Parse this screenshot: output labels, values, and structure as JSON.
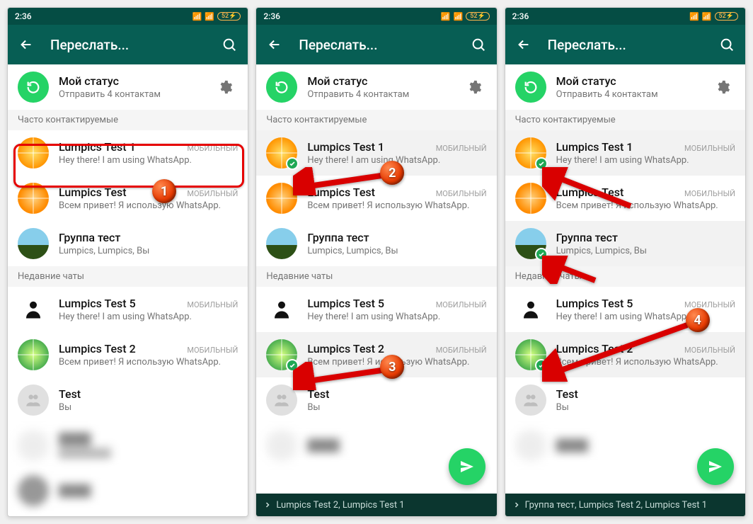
{
  "status_bar": {
    "time": "2:36",
    "battery": "52"
  },
  "app_bar": {
    "title": "Переслать..."
  },
  "status_row": {
    "title": "Мой статус",
    "sub": "Отправить 4 контактам"
  },
  "sections": {
    "frequent": "Часто контактируемые",
    "recent": "Недавние чаты"
  },
  "contacts": {
    "lumpics1": {
      "name": "Lumpics Test 1",
      "sub": "Hey there! I am using WhatsApp.",
      "meta": "МОБИЛЬНЫЙ"
    },
    "lumpics": {
      "name": "Lumpics Test",
      "sub": "Всем привет! Я использую WhatsApp.",
      "meta": "МОБИЛЬНЫЙ"
    },
    "group": {
      "name": "Группа тест",
      "sub": "Lumpics, Lumpics, Вы"
    },
    "lumpics5": {
      "name": "Lumpics Test 5",
      "sub": "Hey there! I am using WhatsApp.",
      "meta": "МОБИЛЬНЫЙ"
    },
    "lumpics2": {
      "name": "Lumpics Test 2",
      "sub": "Всем привет! Я использую WhatsApp.",
      "meta": "МОБИЛЬНЫЙ"
    },
    "test": {
      "name": "Test",
      "sub": "Вы"
    }
  },
  "bottom_bar": {
    "screen2": "Lumpics Test 2, Lumpics Test 1",
    "screen3": "Группа тест, Lumpics Test 2, Lumpics Test 1"
  },
  "callouts": {
    "c1": "1",
    "c2": "2",
    "c3": "3",
    "c4": "4"
  }
}
